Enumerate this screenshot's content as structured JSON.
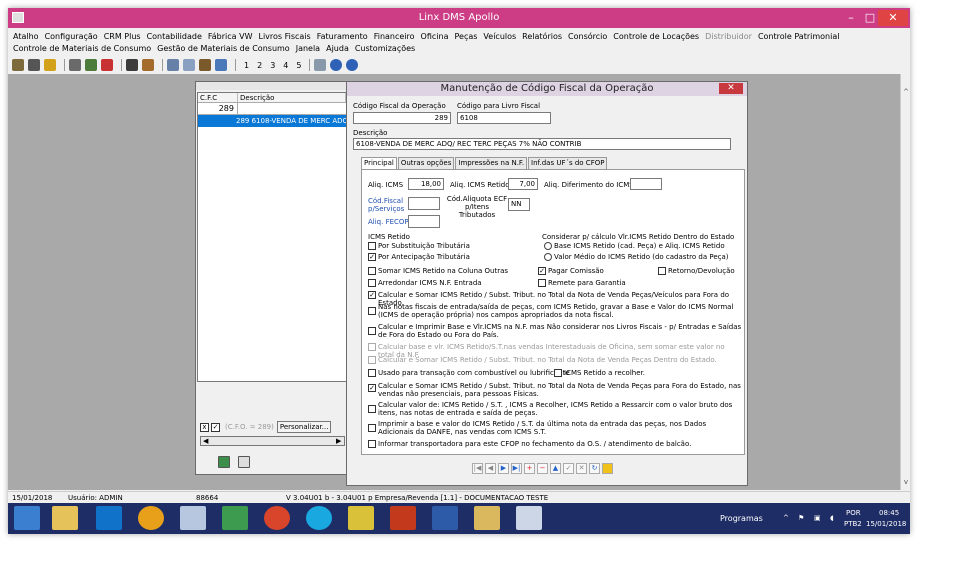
{
  "app": {
    "title": "Linx DMS Apollo",
    "min": "–",
    "max": "□",
    "close": "✕"
  },
  "menu": {
    "row1": [
      "Atalho",
      "Configuração",
      "CRM Plus",
      "Contabilidade",
      "Fábrica VW",
      "Livros Fiscais",
      "Faturamento",
      "Financeiro",
      "Oficina",
      "Peças",
      "Veículos",
      "Relatórios",
      "Consórcio",
      "Controle de Locações",
      "Distribuidor",
      "Controle Patrimonial"
    ],
    "row2": [
      "Controle de Materiais de Consumo",
      "Gestão de Materiais de Consumo",
      "Janela",
      "Ajuda",
      "Customizações"
    ],
    "disabled": "Distribuidor"
  },
  "toolbar": {
    "numbers": [
      "1",
      "2",
      "3",
      "4",
      "5"
    ]
  },
  "list": {
    "col1": "C.F.C",
    "col2": "Descrição",
    "filter": "289",
    "row": "289 6108-VENDA DE MERC ADQ/",
    "filter_label": "(C.F.O. = 289)",
    "personalizar": "Personalizar..."
  },
  "form": {
    "title": "Manutenção de Código Fiscal da Operação",
    "close": "✕",
    "codigo_label": "Código Fiscal da Operação",
    "codigo_value": "289",
    "livro_label": "Código para Livro Fiscal",
    "livro_value": "6108",
    "descricao_label": "Descrição",
    "descricao_value": "6108-VENDA DE MERC ADQ/ REC TERC PEÇAS 7% NÃO CONTRIB",
    "tabs": [
      "Principal",
      "Outras opções",
      "Impressões na N.F.",
      "Inf.das UF´s do CFOP"
    ],
    "aliq_icms_label": "Aliq. ICMS",
    "aliq_icms_value": "18,00",
    "aliq_retido_label": "Aliq. ICMS Retido",
    "aliq_retido_value": "7,00",
    "aliq_dif_label": "Aliq. Diferimento do ICMS:",
    "cod_fiscal_label": "Cód.Fiscal p/Serviços",
    "aliquota_ecf_label": "Cód.Aliquota ECF p/Itens Tributados",
    "aliquota_ecf_value": "NN",
    "fecop_label": "Aliq. FECOP",
    "icms_retido_title": "ICMS Retido",
    "por_substituicao": "Por Substituição Tributária",
    "por_antecipacao": "Por Antecipação Tributária",
    "considerar_title": "Considerar p/ cálculo Vlr.ICMS Retido Dentro do Estado",
    "radio1": "Base ICMS Retido (cad. Peça) e Aliq. ICMS Retido",
    "radio2": "Valor Médio do ICMS Retido (do cadastro da Peça)",
    "somar_coluna": "Somar ICMS Retido na Coluna Outras",
    "pagar_comissao": "Pagar Comissão",
    "retorno": "Retorno/Devolução",
    "arredondar": "Arredondar ICMS N.F. Entrada",
    "remete": "Remete para Garantia",
    "opt1": "Calcular e Somar ICMS Retido / Subst. Tribut. no Total da Nota de Venda Peças/Veículos para Fora do Estado.",
    "opt2": "Nas notas fiscais de entrada/saída de peças, com ICMS Retido, gravar a Base e Valor do ICMS Normal (ICMS de operação própria) nos campos apropriados da nota fiscal.",
    "opt3": "Calcular e Imprimir Base e Vlr.ICMS na N.F. mas Não considerar nos Livros Fiscais - p/ Entradas e Saídas de Fora do Estado ou Fora do País.",
    "opt4": "Calcular base e vlr. ICMS Retido/S.T.nas vendas Interestaduais de Oficina, sem somar este valor no total da N.F.",
    "opt5": "Calcular e Somar ICMS Retido / Subst. Tribut. no Total da Nota de Venda Peças Dentro do Estado.",
    "opt6": "Usado para transação com combustível ou lubrificante",
    "opt6b": "ICMS Retido a recolher.",
    "opt7": "Calcular e Somar ICMS Retido / Subst. Tribut. no Total da Nota de Venda Peças para Fora do Estado, nas vendas não presenciais, para pessoas Físicas.",
    "opt8": "Calcular valor de: ICMS Retido / S.T. , ICMS a Recolher, ICMS Retido a Ressarcir com o valor bruto dos itens, nas notas de entrada e saída de peças.",
    "opt9": "Imprimir a base e valor do ICMS Retido / S.T. da última nota da entrada das peças, nos Dados Adicionais da DANFE, nas vendas com ICMS S.T.",
    "opt10": "Informar transportadora para este CFOP no fechamento da O.S. / atendimento de balcão."
  },
  "status": {
    "date": "15/01/2018",
    "user": "Usuário: ADMIN",
    "code": "88664",
    "version": "V 3.04U01 b  -  3.04U01 p   Empresa/Revenda [1.1] - DOCUMENTACAO TESTE"
  },
  "taskbar": {
    "programas": "Programas",
    "lang1": "POR",
    "lang2": "PTB2",
    "time": "08:45",
    "date": "15/01/2018"
  },
  "colors": {
    "titlebar": "#cc3d85",
    "selection": "#0a78d7",
    "taskbar": "#1f2d66"
  }
}
